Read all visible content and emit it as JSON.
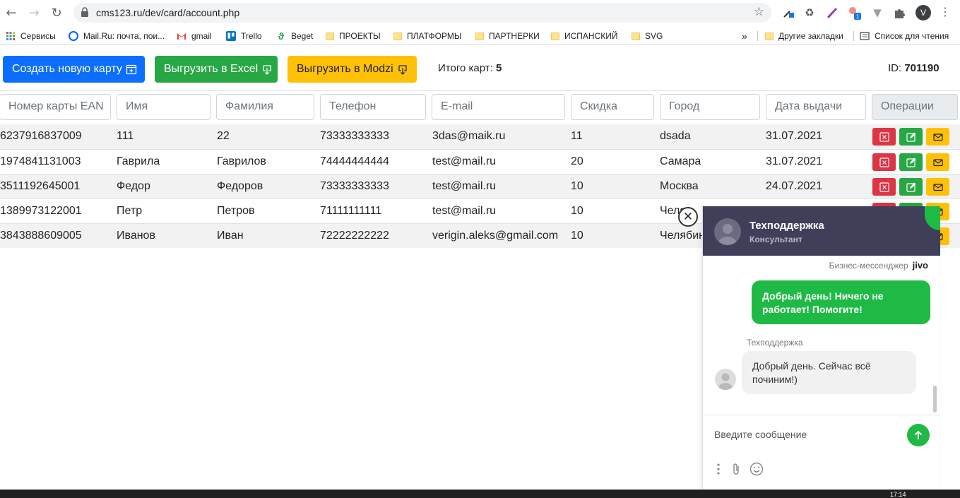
{
  "browser": {
    "url": "cms123.ru/dev/card/account.php",
    "profile_initial": "V",
    "bookmarks": [
      {
        "label": "Сервисы"
      },
      {
        "label": "Mail.Ru: почта, пои..."
      },
      {
        "label": "gmail"
      },
      {
        "label": "Trello"
      },
      {
        "label": "Beget"
      },
      {
        "label": "ПРОЕКТЫ"
      },
      {
        "label": "ПЛАТФОРМЫ"
      },
      {
        "label": "ПАРТНЕРКИ"
      },
      {
        "label": "ИСПАНСКИЙ"
      },
      {
        "label": "SVG"
      }
    ],
    "overflow_label": "»",
    "other_bookmarks": "Другие закладки",
    "reading_list": "Список для чтения",
    "extension_badge": "1"
  },
  "toolbar": {
    "create_label": "Создать новую карту",
    "excel_label": "Выгрузить в Excel",
    "modzi_label": "Выгрузить в Modzi",
    "total_label": "Итого карт:",
    "total_value": "5",
    "id_label": "ID:",
    "id_value": "701190"
  },
  "filters": {
    "ean": "Номер карты EAN",
    "name": "Имя",
    "surname": "Фамилия",
    "phone": "Телефон",
    "email": "E-mail",
    "discount": "Скидка",
    "city": "Город",
    "date": "Дата выдачи",
    "operations": "Операции"
  },
  "rows": [
    {
      "ean": "6237916837009",
      "name": "111",
      "surname": "22",
      "phone": "73333333333",
      "email": "3das@maik.ru",
      "discount": "11",
      "city": "dsada",
      "date": "31.07.2021"
    },
    {
      "ean": "1974841131003",
      "name": "Гаврила",
      "surname": "Гаврилов",
      "phone": "74444444444",
      "email": "test@mail.ru",
      "discount": "20",
      "city": "Самара",
      "date": "31.07.2021"
    },
    {
      "ean": "3511192645001",
      "name": "Федор",
      "surname": "Федоров",
      "phone": "73333333333",
      "email": "test@mail.ru",
      "discount": "10",
      "city": "Москва",
      "date": "24.07.2021"
    },
    {
      "ean": "1389973122001",
      "name": "Петр",
      "surname": "Петров",
      "phone": "71111111111",
      "email": "test@mail.ru",
      "discount": "10",
      "city": "Челя",
      "date": ""
    },
    {
      "ean": "3843888609005",
      "name": "Иванов",
      "surname": "Иван",
      "phone": "72222222222",
      "email": "verigin.aleks@gmail.com",
      "discount": "10",
      "city": "Челябин",
      "date": ""
    }
  ],
  "chat": {
    "agent_name": "Техподдержка",
    "agent_role": "Консультант",
    "brand_text": "Бизнес-мессенджер",
    "brand_logo": "jivo",
    "user_message": "Добрый день! Ничего не работает! Помогите!",
    "agent_label": "Техподдержка",
    "agent_message": "Добрый день. Сейчас всё починим!)",
    "input_placeholder": "Введите сообщение"
  },
  "taskbar": {
    "clock": "17:14"
  },
  "colors": {
    "primary": "#0d6efd",
    "success": "#28a745",
    "warning": "#ffc107",
    "danger": "#dc3545",
    "chat_header": "#3f3f5a",
    "chat_green": "#1fba45"
  }
}
